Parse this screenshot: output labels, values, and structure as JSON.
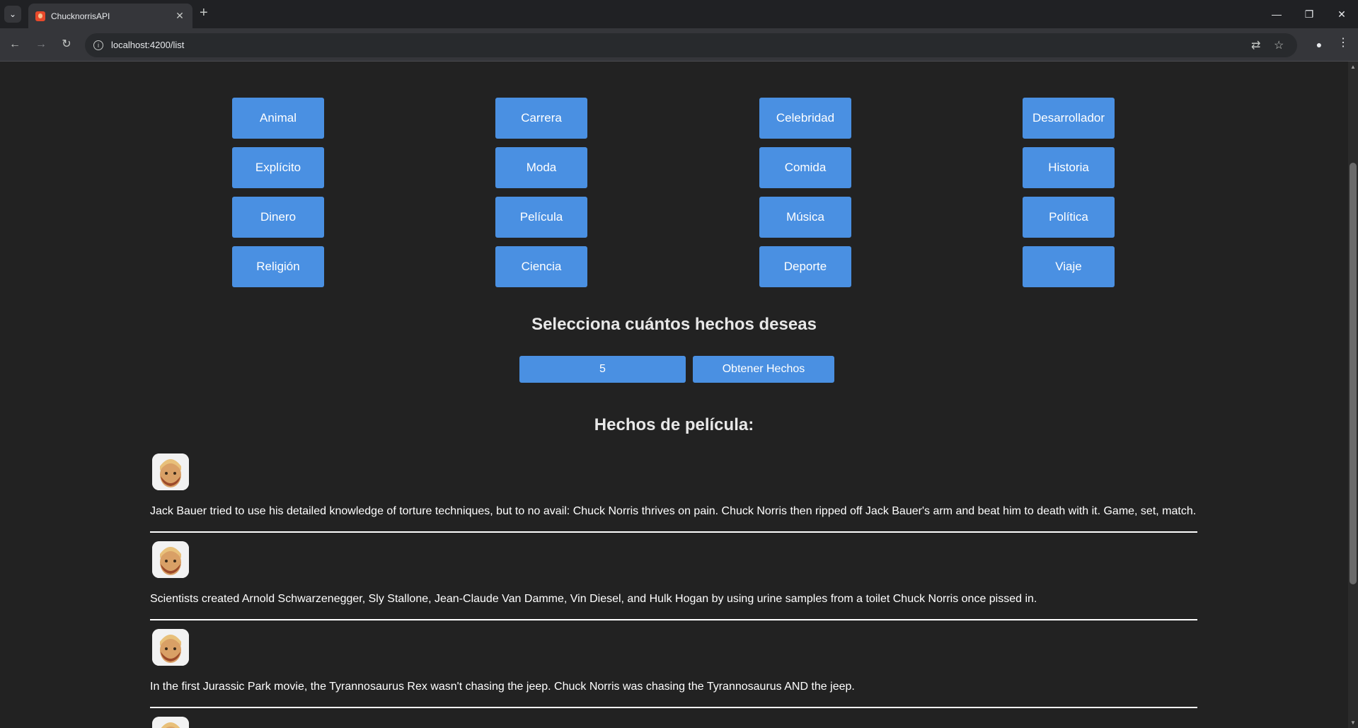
{
  "browser": {
    "tab_title": "ChucknorrisAPI",
    "url": "localhost:4200/list",
    "icons": [
      "tab-search-icon",
      "favicon-icon",
      "close-icon",
      "plus-icon",
      "minimize-icon",
      "restore-icon",
      "close-window-icon",
      "back-icon",
      "forward-icon",
      "reload-icon",
      "info-icon",
      "translate-icon",
      "star-icon",
      "profile-icon",
      "kebab-menu-icon"
    ]
  },
  "categories": [
    "Animal",
    "Carrera",
    "Celebridad",
    "Desarrollador",
    "Explícito",
    "Moda",
    "Comida",
    "Historia",
    "Dinero",
    "Película",
    "Música",
    "Política",
    "Religión",
    "Ciencia",
    "Deporte",
    "Viaje"
  ],
  "selector": {
    "heading": "Selecciona cuántos hechos deseas",
    "count_value": "5",
    "get_button_label": "Obtener Hechos"
  },
  "results": {
    "heading": "Hechos de película:",
    "facts": [
      "Jack Bauer tried to use his detailed knowledge of torture techniques, but to no avail: Chuck Norris thrives on pain. Chuck Norris then ripped off Jack Bauer's arm and beat him to death with it. Game, set, match.",
      "Scientists created Arnold Schwarzenegger, Sly Stallone, Jean-Claude Van Damme, Vin Diesel, and Hulk Hogan by using urine samples from a toilet Chuck Norris once pissed in.",
      "In the first Jurassic Park movie, the Tyrannosaurus Rex wasn't chasing the jeep. Chuck Norris was chasing the Tyrannosaurus AND the jeep."
    ]
  },
  "colors": {
    "page_background": "#222222",
    "button_blue": "#4a90e2",
    "text": "#ffffff"
  }
}
